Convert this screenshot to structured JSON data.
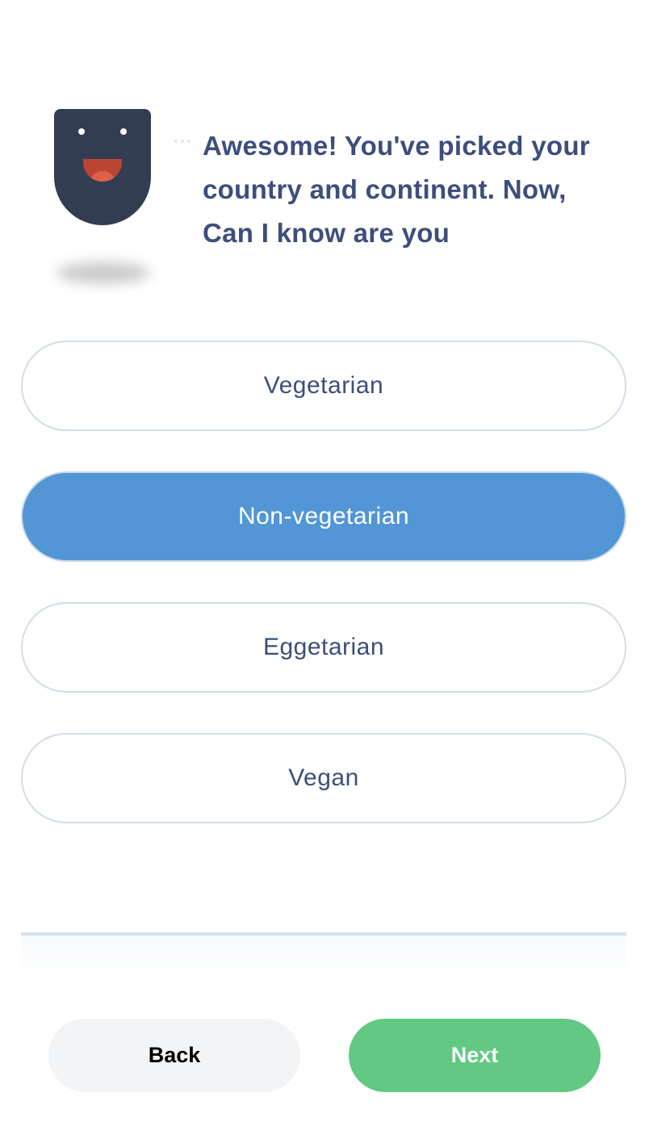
{
  "bot": {
    "avatar_icon": "smiling-robot-icon",
    "message": "Awesome! You've picked your country and continent. Now, Can I know are you"
  },
  "options": [
    {
      "label": "Vegetarian",
      "selected": false
    },
    {
      "label": "Non-vegetarian",
      "selected": true
    },
    {
      "label": "Eggetarian",
      "selected": false
    },
    {
      "label": "Vegan",
      "selected": false
    }
  ],
  "footer": {
    "back_label": "Back",
    "next_label": "Next"
  },
  "colors": {
    "text": "#3d4e7c",
    "selected": "#5296d5",
    "next": "#62c982",
    "back": "#f3f4f6",
    "avatar": "#323d51"
  }
}
